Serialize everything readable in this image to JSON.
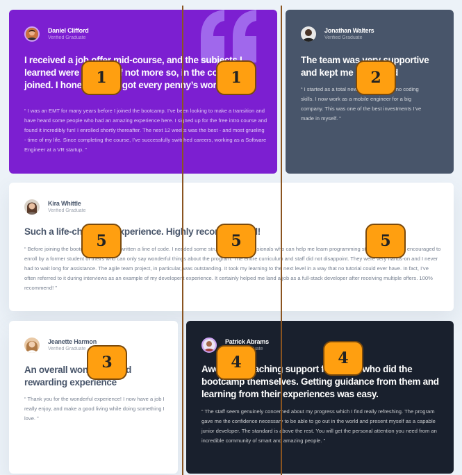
{
  "colors": {
    "page_bg": "#ecf2f8",
    "violet": "#7c1fd1",
    "slate": "#48556a",
    "white": "#ffffff",
    "dark": "#19202d",
    "badge": "#ff9f10",
    "guide_line": "#8a5420"
  },
  "testimonials": [
    {
      "name": "Daniel Clifford",
      "role": "Verified Graduate",
      "headline": "I received a job offer mid-course, and the subjects I learned were current, if not more so, in the company I joined. I honestly feel I got every penny’s worth.",
      "body": "“ I was an EMT for many years before I joined the bootcamp. I’ve been looking to make a transition and have heard some people who had an amazing experience here. I signed up for the free intro course and found it incredibly fun! I enrolled shortly thereafter. The next 12 weeks was the best - and most grueling - time of my life. Since completing the course, I’ve successfully switched careers, working as a Software Engineer at a VR startup. ”",
      "avatar_icon": "avatar-daniel-icon"
    },
    {
      "name": "Jonathan Walters",
      "role": "Verified Graduate",
      "headline": "The team was very supportive and kept me motivated",
      "body": "“ I started as a total newbie with virtually no coding skills. I now work as a mobile engineer for a big company. This was one of the best investments I’ve made in myself. ”",
      "avatar_icon": "avatar-jonathan-icon"
    },
    {
      "name": "Kira Whittle",
      "role": "Verified Graduate",
      "headline": "Such a life-changing experience. Highly recommended!",
      "body": "“ Before joining the bootcamp, I’ve never written a line of code. I needed some structure from professionals who can help me learn programming step by step. I was encouraged to enroll by a former student of theirs who can only say wonderful things about the program. The entire curriculum and staff did not disappoint. They were very hands-on and I never had to wait long for assistance. The agile team project, in particular, was outstanding. It took my learning to the next level in a way that no tutorial could ever have. In fact, I’ve often referred to it during interviews as an example of my developent experience. It certainly helped me land a job as a full-stack developer after receiving multiple offers. 100% recommend! ”",
      "avatar_icon": "avatar-kira-icon"
    },
    {
      "name": "Jeanette Harmon",
      "role": "Verified Graduate",
      "headline": "An overall wonderful and rewarding experience",
      "body": "“ Thank you for the wonderful experience! I now have a job I really enjoy, and make a good living while doing something I love. ”",
      "avatar_icon": "avatar-jeanette-icon"
    },
    {
      "name": "Patrick Abrams",
      "role": "Verified Graduate",
      "headline": "Awesome teaching support from TAs who did the bootcamp themselves. Getting guidance from them and learning from their experiences was easy.",
      "body": "“ The staff seem genuinely concerned about my progress which I find really refreshing. The program gave me the confidence necessary to be able to go out in the world and present myself as a capable junior developer. The standard is above the rest. You will get the personal attention you need from an incredible community of smart and amazing people. ”",
      "avatar_icon": "avatar-patrick-icon"
    }
  ],
  "decoration": {
    "quote_icon": "quotation-mark-icon"
  },
  "annotation_badges": [
    "1",
    "1",
    "2",
    "5",
    "5",
    "5",
    "3",
    "4",
    "4"
  ]
}
